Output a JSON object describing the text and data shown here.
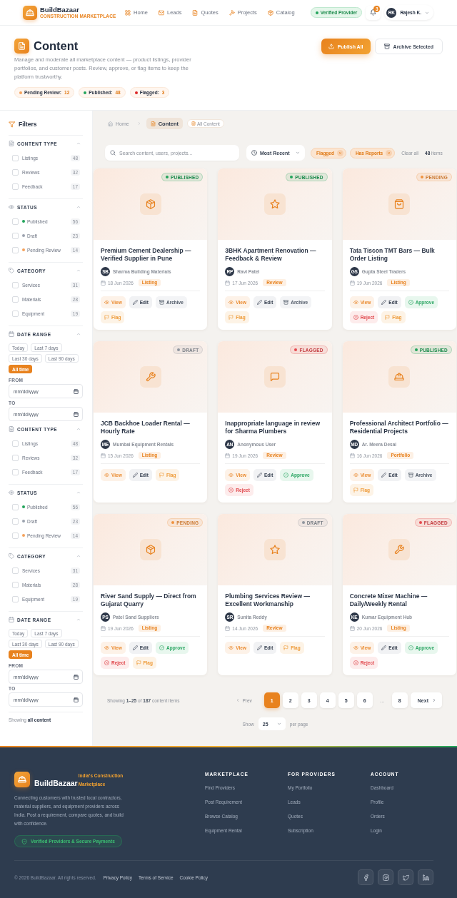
{
  "header": {
    "brand": {
      "name": "BuildBazaar",
      "tagline": "CONSTRUCTION MARKETPLACE"
    },
    "nav": [
      {
        "label": "Home",
        "selected": false
      },
      {
        "label": "Leads",
        "selected": false
      },
      {
        "label": "Quotes",
        "selected": false
      },
      {
        "label": "Projects",
        "selected": false
      },
      {
        "label": "Catalog",
        "selected": false
      }
    ],
    "verified_badge": "Verified Provider",
    "notification_count": "3",
    "user": {
      "initials": "RK",
      "name": "Rajesh K."
    }
  },
  "page_header": {
    "title": "Content",
    "description": "Manage and moderate all marketplace content — product listings, provider portfolios, and customer posts. Review, approve, or flag items to keep the platform trustworthy.",
    "stats": [
      {
        "label": "Pending Review:",
        "value": "12",
        "color": "#f5a25d"
      },
      {
        "label": "Published:",
        "value": "48",
        "color": "#22a35a"
      },
      {
        "label": "Flagged:",
        "value": "3",
        "color": "#dc2626"
      }
    ],
    "actions": [
      {
        "label": "Publish All",
        "kind": "primary"
      },
      {
        "label": "Archive Selected",
        "kind": "secondary"
      }
    ]
  },
  "filters": {
    "title": "Filters",
    "sections": [
      {
        "kind": "checklist",
        "title": "CONTENT TYPE",
        "expanded": true,
        "options": [
          {
            "label": "Listings",
            "count": "48",
            "checked": false
          },
          {
            "label": "Reviews",
            "count": "32",
            "checked": false
          },
          {
            "label": "Feedback",
            "count": "17",
            "checked": false
          }
        ]
      },
      {
        "kind": "checklist",
        "title": "STATUS",
        "expanded": true,
        "options": [
          {
            "label": "Published",
            "count": "56",
            "checked": false,
            "color": "#22a35a"
          },
          {
            "label": "Draft",
            "count": "23",
            "checked": false,
            "color": "#9ca3af"
          },
          {
            "label": "Pending Review",
            "count": "14",
            "checked": false,
            "color": "#f5a25d"
          }
        ]
      },
      {
        "kind": "checklist",
        "title": "CATEGORY",
        "expanded": true,
        "options": [
          {
            "label": "Services",
            "count": "31",
            "checked": false
          },
          {
            "label": "Materials",
            "count": "28",
            "checked": false
          },
          {
            "label": "Equipment",
            "count": "19",
            "checked": false
          }
        ]
      },
      {
        "kind": "dates",
        "title": "DATE RANGE",
        "expanded": true,
        "presets": [
          {
            "label": "Today",
            "selected": false
          },
          {
            "label": "Last 7 days",
            "selected": false
          },
          {
            "label": "Last 30 days",
            "selected": false
          },
          {
            "label": "Last 90 days",
            "selected": false
          },
          {
            "label": "All time",
            "selected": true
          }
        ],
        "from": {
          "label": "FROM",
          "placeholder": "mm/dd/yyyy"
        },
        "to": {
          "label": "TO",
          "placeholder": "mm/dd/yyyy"
        }
      },
      {
        "kind": "checklist",
        "title": "CONTENT TYPE",
        "expanded": true,
        "options": [
          {
            "label": "Listings",
            "count": "48",
            "checked": false
          },
          {
            "label": "Reviews",
            "count": "32",
            "checked": false
          },
          {
            "label": "Feedback",
            "count": "17",
            "checked": false
          }
        ]
      },
      {
        "kind": "checklist",
        "title": "STATUS",
        "expanded": true,
        "options": [
          {
            "label": "Published",
            "count": "56",
            "checked": false,
            "color": "#22a35a"
          },
          {
            "label": "Draft",
            "count": "23",
            "checked": false,
            "color": "#9ca3af"
          },
          {
            "label": "Pending Review",
            "count": "14",
            "checked": false,
            "color": "#f5a25d"
          }
        ]
      },
      {
        "kind": "checklist",
        "title": "CATEGORY",
        "expanded": true,
        "options": [
          {
            "label": "Services",
            "count": "31",
            "checked": false
          },
          {
            "label": "Materials",
            "count": "28",
            "checked": false
          },
          {
            "label": "Equipment",
            "count": "19",
            "checked": false
          }
        ]
      },
      {
        "kind": "dates",
        "title": "DATE RANGE",
        "expanded": true,
        "presets": [
          {
            "label": "Today",
            "selected": false
          },
          {
            "label": "Last 7 days",
            "selected": false
          },
          {
            "label": "Last 30 days",
            "selected": false
          },
          {
            "label": "Last 90 days",
            "selected": false
          },
          {
            "label": "All time",
            "selected": true
          }
        ],
        "from": {
          "label": "FROM",
          "placeholder": "mm/dd/yyyy"
        },
        "to": {
          "label": "TO",
          "placeholder": "mm/dd/yyyy"
        }
      }
    ],
    "summary": "Showing **all content**"
  },
  "content": {
    "breadcrumb": [
      {
        "label": "Home",
        "selected": false
      },
      {
        "label": "Content",
        "selected": true
      }
    ],
    "scope_tag": "All Content",
    "search": {
      "placeholder": "Search content, users, projects..."
    },
    "sort": {
      "value": "Most Recent"
    },
    "active_filters": [
      {
        "label": "Flagged"
      },
      {
        "label": "Has Reports"
      }
    ],
    "clear_all": "Clear all",
    "item_count": "**48** items",
    "cards": [
      {
        "badge": {
          "label": "PUBLISHED",
          "color": "#22a35a"
        },
        "title": "Premium Cement Dealership — Verified Supplier in Pune",
        "author": {
          "initials": "SB",
          "name": "Sharma Building Materials"
        },
        "date": "18 Jun 2026",
        "type": "Listing",
        "actions": [
          {
            "kind": "view",
            "label": "View"
          },
          {
            "kind": "edit",
            "label": "Edit"
          },
          {
            "kind": "archive",
            "label": "Archive"
          },
          {
            "kind": "flag",
            "label": "Flag"
          }
        ]
      },
      {
        "badge": {
          "label": "PUBLISHED",
          "color": "#22a35a"
        },
        "title": "3BHK Apartment Renovation — Feedback & Review",
        "author": {
          "initials": "RP",
          "name": "Ravi Patel"
        },
        "date": "17 Jun 2026",
        "type": "Review",
        "actions": [
          {
            "kind": "view",
            "label": "View"
          },
          {
            "kind": "edit",
            "label": "Edit"
          },
          {
            "kind": "archive",
            "label": "Archive"
          },
          {
            "kind": "flag",
            "label": "Flag"
          }
        ]
      },
      {
        "badge": {
          "label": "PENDING",
          "color": "#f0923e"
        },
        "title": "Tata Tiscon TMT Bars — Bulk Order Listing",
        "author": {
          "initials": "GS",
          "name": "Gupta Steel Traders"
        },
        "date": "19 Jun 2026",
        "type": "Listing",
        "actions": [
          {
            "kind": "view",
            "label": "View"
          },
          {
            "kind": "edit",
            "label": "Edit"
          },
          {
            "kind": "approve",
            "label": "Approve"
          },
          {
            "kind": "reject",
            "label": "Reject"
          },
          {
            "kind": "flag",
            "label": "Flag"
          }
        ]
      },
      {
        "badge": {
          "label": "DRAFT",
          "color": "#8f959e"
        },
        "title": "JCB Backhoe Loader Rental — Hourly Rate",
        "author": {
          "initials": "ME",
          "name": "Mumbai Equipment Rentals"
        },
        "date": "15 Jun 2026",
        "type": "Listing",
        "actions": [
          {
            "kind": "view",
            "label": "View"
          },
          {
            "kind": "edit",
            "label": "Edit"
          },
          {
            "kind": "flag",
            "label": "Flag"
          }
        ]
      },
      {
        "badge": {
          "label": "FLAGGED",
          "color": "#e5484d"
        },
        "title": "Inappropriate language in review for Sharma Plumbers",
        "author": {
          "initials": "AN",
          "name": "Anonymous User"
        },
        "date": "19 Jun 2026",
        "type": "Review",
        "actions": [
          {
            "kind": "view",
            "label": "View"
          },
          {
            "kind": "edit",
            "label": "Edit"
          },
          {
            "kind": "approve",
            "label": "Approve"
          },
          {
            "kind": "reject",
            "label": "Reject"
          }
        ]
      },
      {
        "badge": {
          "label": "PUBLISHED",
          "color": "#22a35a"
        },
        "title": "Professional Architect Portfolio — Residential Projects",
        "author": {
          "initials": "MD",
          "name": "Ar. Meera Desai"
        },
        "date": "16 Jun 2026",
        "type": "Portfolio",
        "actions": [
          {
            "kind": "view",
            "label": "View"
          },
          {
            "kind": "edit",
            "label": "Edit"
          },
          {
            "kind": "archive",
            "label": "Archive"
          },
          {
            "kind": "flag",
            "label": "Flag"
          }
        ]
      },
      {
        "badge": {
          "label": "PENDING",
          "color": "#f0923e"
        },
        "title": "River Sand Supply — Direct from Gujarat Quarry",
        "author": {
          "initials": "PS",
          "name": "Patel Sand Suppliers"
        },
        "date": "19 Jun 2026",
        "type": "Listing",
        "actions": [
          {
            "kind": "view",
            "label": "View"
          },
          {
            "kind": "edit",
            "label": "Edit"
          },
          {
            "kind": "approve",
            "label": "Approve"
          },
          {
            "kind": "reject",
            "label": "Reject"
          },
          {
            "kind": "flag",
            "label": "Flag"
          }
        ]
      },
      {
        "badge": {
          "label": "DRAFT",
          "color": "#8f959e"
        },
        "title": "Plumbing Services Review — Excellent Workmanship",
        "author": {
          "initials": "SR",
          "name": "Sunita Reddy"
        },
        "date": "14 Jun 2026",
        "type": "Review",
        "actions": [
          {
            "kind": "view",
            "label": "View"
          },
          {
            "kind": "edit",
            "label": "Edit"
          },
          {
            "kind": "flag",
            "label": "Flag"
          }
        ]
      },
      {
        "badge": {
          "label": "FLAGGED",
          "color": "#e5484d"
        },
        "title": "Concrete Mixer Machine — Daily/Weekly Rental",
        "author": {
          "initials": "KE",
          "name": "Kumar Equipment Hub"
        },
        "date": "20 Jun 2026",
        "type": "Listing",
        "actions": [
          {
            "kind": "view",
            "label": "View"
          },
          {
            "kind": "edit",
            "label": "Edit"
          },
          {
            "kind": "approve",
            "label": "Approve"
          },
          {
            "kind": "reject",
            "label": "Reject"
          }
        ]
      }
    ],
    "pagination": {
      "summary": "Showing **1–25** of **187** content items",
      "prev": {
        "label": "Prev",
        "disabled": true
      },
      "pages": [
        {
          "label": "1",
          "selected": true
        },
        {
          "label": "2",
          "selected": false
        },
        {
          "label": "3",
          "selected": false
        },
        {
          "label": "4",
          "selected": false
        },
        {
          "label": "5",
          "selected": false
        },
        {
          "label": "6",
          "selected": false
        }
      ],
      "ellipsis": "…",
      "last_page": {
        "label": "8",
        "selected": false
      },
      "next": {
        "label": "Next",
        "disabled": false
      },
      "per_page": {
        "label": "Show",
        "value": "25",
        "suffix": "per page"
      }
    }
  },
  "footer": {
    "brand": {
      "name": "BuildBazaar",
      "tagline": "India's Construction Marketplace"
    },
    "description": "Connecting customers with trusted local contractors, material suppliers, and equipment providers across India. Post a requirement, compare quotes, and build with confidence.",
    "badge": "Verified Providers & Secure Payments",
    "columns": [
      {
        "title": "MARKETPLACE",
        "links": [
          "Find Providers",
          "Post Requirement",
          "Browse Catalog",
          "Equipment Rental"
        ]
      },
      {
        "title": "FOR PROVIDERS",
        "links": [
          "My Portfolio",
          "Leads",
          "Quotes",
          "Subscription"
        ]
      },
      {
        "title": "ACCOUNT",
        "links": [
          "Dashboard",
          "Profile",
          "Orders",
          "Login"
        ]
      }
    ],
    "copyright": "© 2026 BuildBazaar. All rights reserved.",
    "legal_links": [
      "Privacy Policy",
      "Terms of Service",
      "Cookie Policy"
    ]
  }
}
